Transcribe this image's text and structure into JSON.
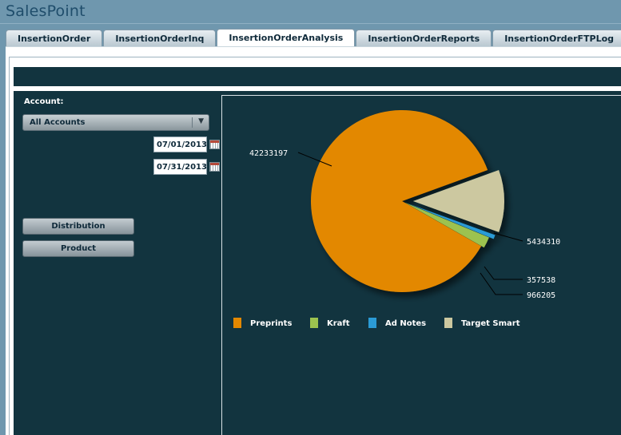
{
  "app": {
    "title": "SalesPoint"
  },
  "tabs": [
    {
      "label": "InsertionOrder"
    },
    {
      "label": "InsertionOrderInq"
    },
    {
      "label": "InsertionOrderAnalysis",
      "active": true
    },
    {
      "label": "InsertionOrderReports"
    },
    {
      "label": "InsertionOrderFTPLog"
    }
  ],
  "filters": {
    "account_label": "Account:",
    "account_value": "All Accounts",
    "start_date": "07/01/2013",
    "end_date": "07/31/2013"
  },
  "buttons": {
    "distribution": "Distribution",
    "product": "Product"
  },
  "colors": {
    "panel": "#12343f",
    "preprints": "#e38800",
    "kraft": "#9cc24f",
    "ad_notes": "#2b9bd6",
    "target_smart": "#ccc8a0"
  },
  "chart_data": {
    "type": "pie",
    "categories": [
      "Preprints",
      "Kraft",
      "Ad Notes",
      "Target Smart"
    ],
    "values": [
      42233197,
      966205,
      357538,
      5434310
    ],
    "data_labels": [
      "42233197",
      "966205",
      "357538",
      "5434310"
    ],
    "legend_position": "bottom"
  }
}
